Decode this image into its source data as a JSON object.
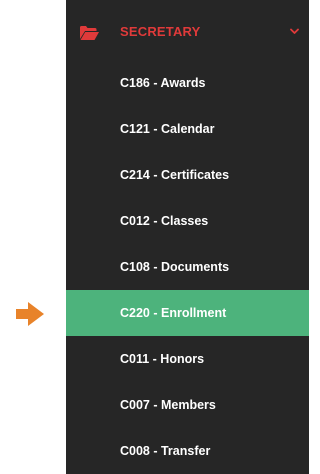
{
  "colors": {
    "accent": "#e03a3a",
    "active": "#4db37c",
    "sidebar_bg": "#262626",
    "pointer": "#e8832a"
  },
  "pointer": {
    "icon": "arrow-right-icon"
  },
  "sidebar": {
    "section": {
      "icon": "folder-open-icon",
      "label": "SECRETARY",
      "expand_icon": "chevron-down-icon",
      "expanded": true
    },
    "items": [
      {
        "label": "C186 - Awards",
        "active": false
      },
      {
        "label": "C121 - Calendar",
        "active": false
      },
      {
        "label": "C214 - Certificates",
        "active": false
      },
      {
        "label": "C012 - Classes",
        "active": false
      },
      {
        "label": "C108 - Documents",
        "active": false
      },
      {
        "label": "C220 - Enrollment",
        "active": true
      },
      {
        "label": "C011 - Honors",
        "active": false
      },
      {
        "label": "C007 - Members",
        "active": false
      },
      {
        "label": "C008 - Transfer",
        "active": false
      }
    ]
  }
}
